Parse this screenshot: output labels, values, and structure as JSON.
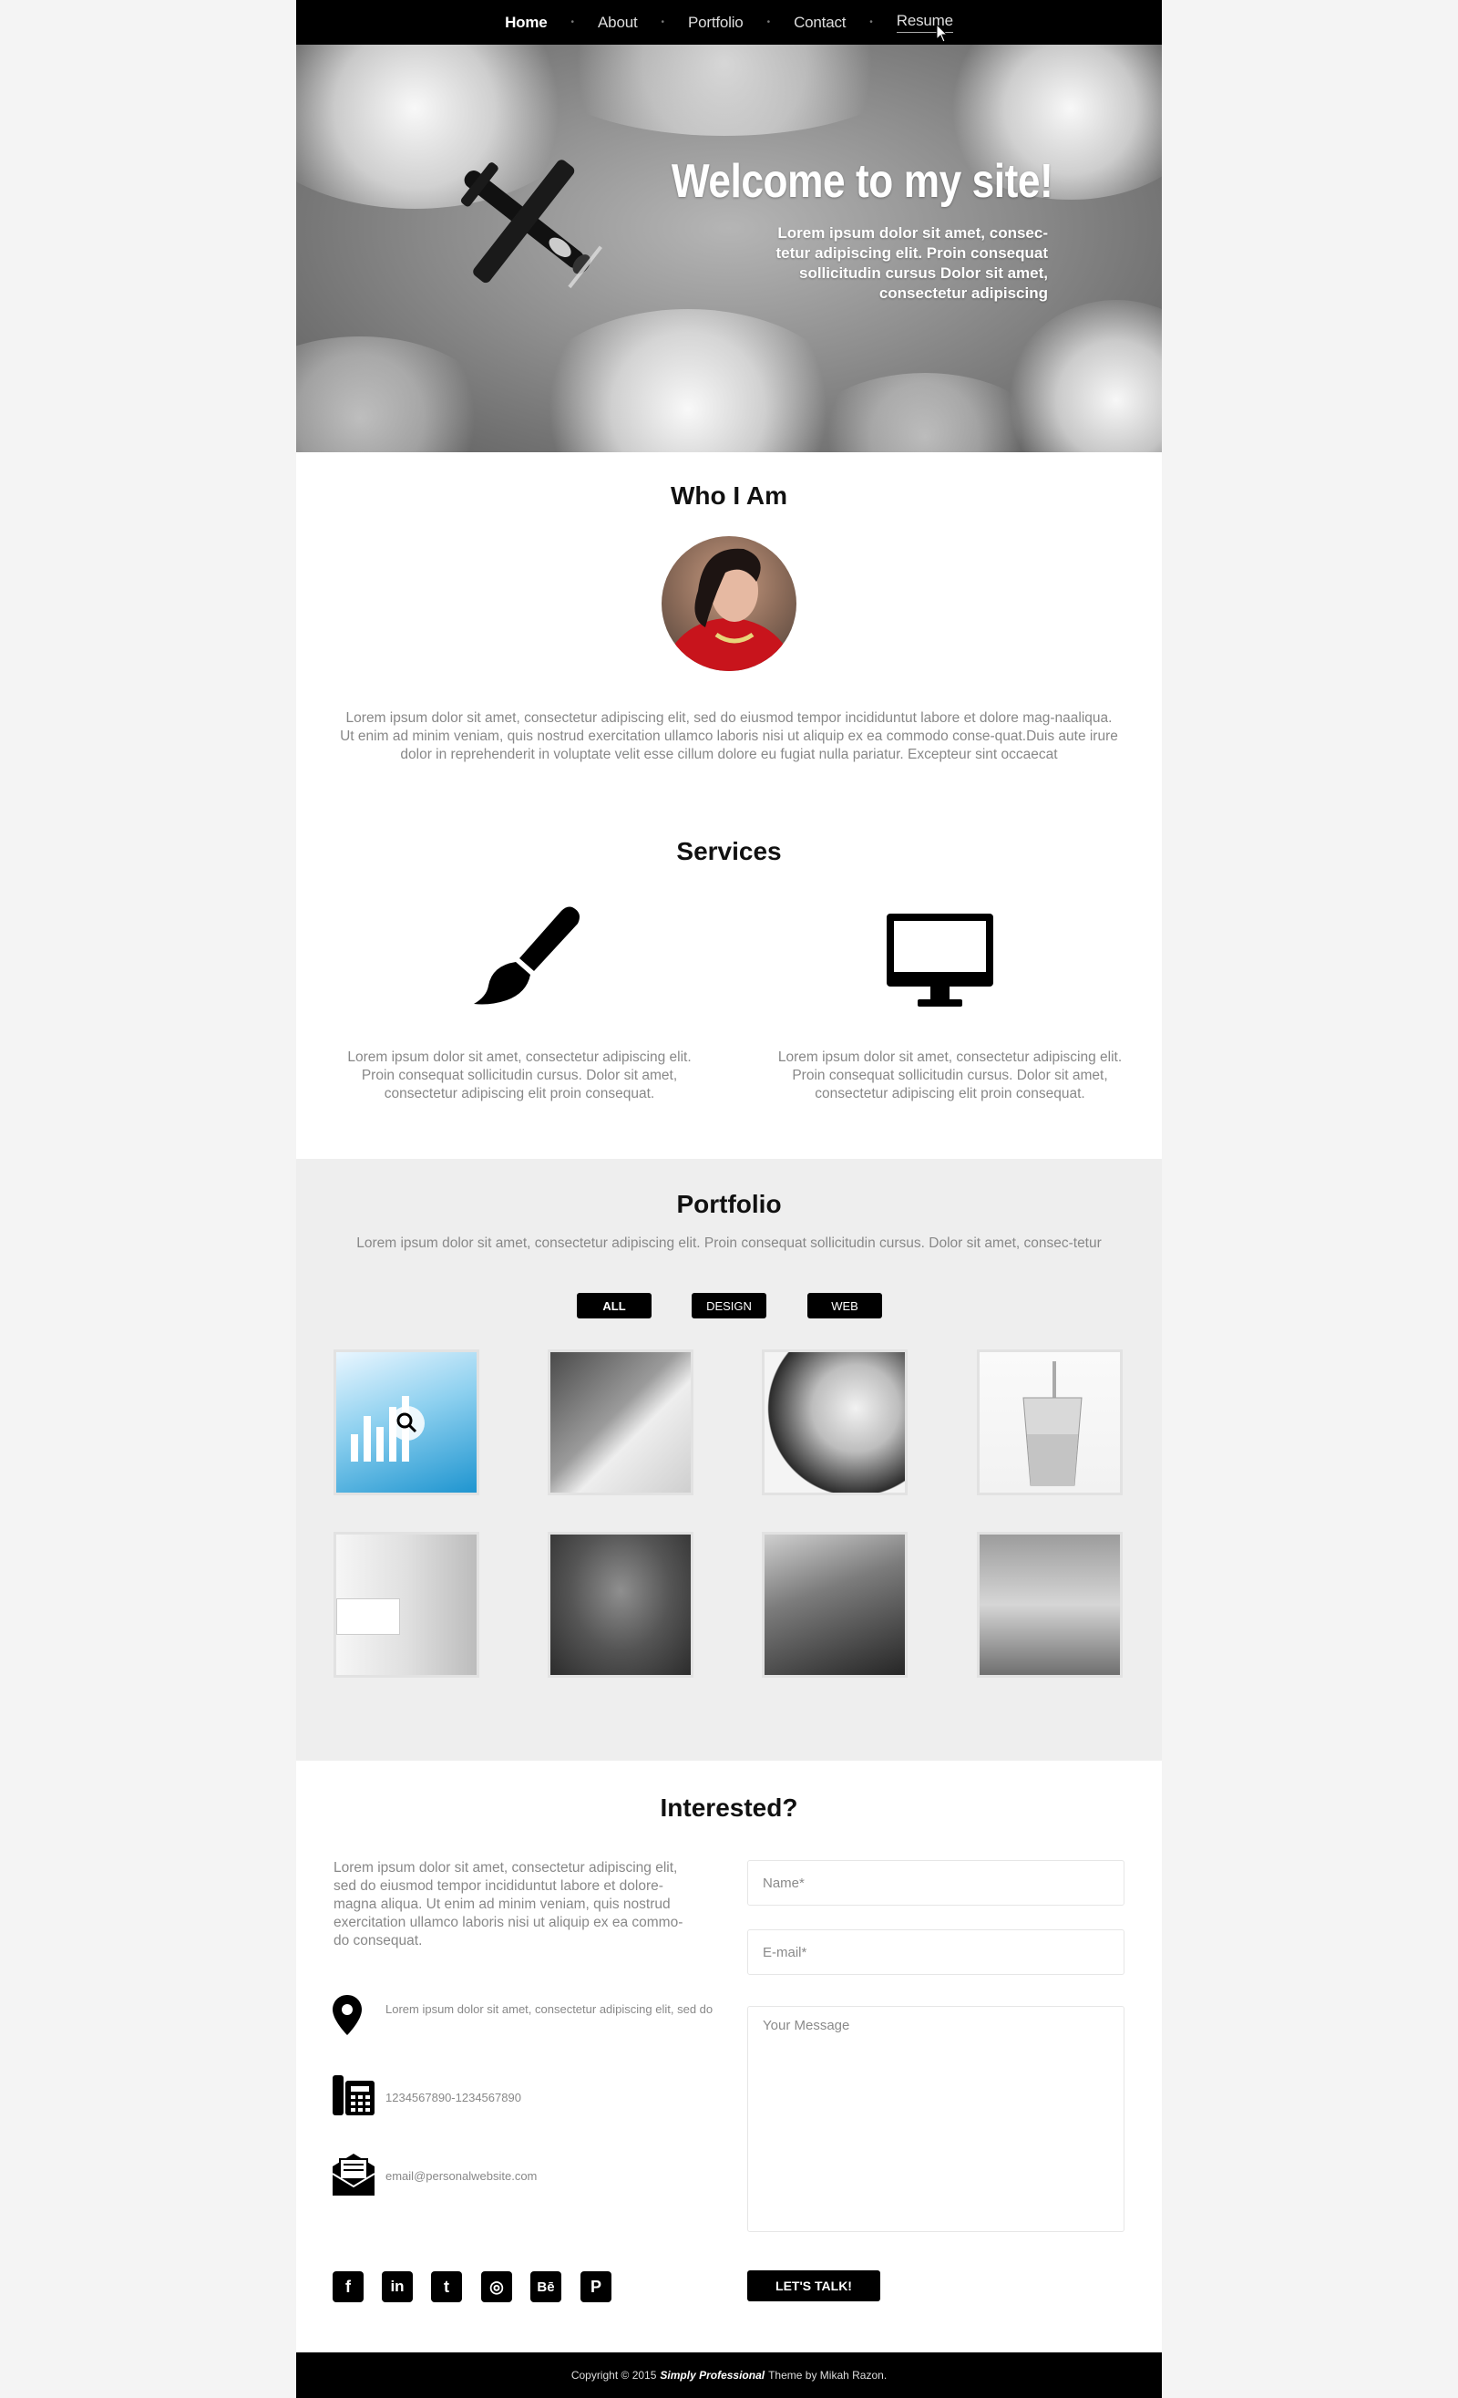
{
  "nav": {
    "items": [
      {
        "label": "Home"
      },
      {
        "label": "About"
      },
      {
        "label": "Portfolio"
      },
      {
        "label": "Contact"
      },
      {
        "label": "Resume"
      }
    ]
  },
  "hero": {
    "title": "Welcome to my site!",
    "text": "Lorem ipsum dolor sit amet, consec-tetur adipiscing elit. Proin consequat sollicitudin cursus Dolor sit amet, consectetur adipiscing"
  },
  "about": {
    "title": "Who I Am",
    "text": "Lorem ipsum dolor sit amet, consectetur adipiscing elit, sed do eiusmod tempor incididuntut labore et dolore mag-naaliqua. Ut enim ad minim veniam, quis  nostrud exercitation ullamco laboris nisi ut aliquip ex ea commodo conse-quat.Duis aute irure dolor in reprehenderit in voluptate velit esse cillum dolore eu fugiat nulla pariatur. Excepteur sint occaecat"
  },
  "services": {
    "title": "Services",
    "items": [
      {
        "icon": "paintbrush-icon",
        "text": "Lorem ipsum dolor sit amet, consectetur adipiscing elit. Proin consequat sollicitudin cursus. Dolor sit amet, consectetur adipiscing elit proin consequat."
      },
      {
        "icon": "monitor-icon",
        "text": "Lorem ipsum dolor sit amet, consectetur adipiscing elit. Proin consequat sollicitudin cursus. Dolor sit amet, consectetur adipiscing elit proin consequat."
      }
    ]
  },
  "portfolio": {
    "title": "Portfolio",
    "text": "Lorem ipsum dolor sit amet, consectetur adipiscing elit. Proin consequat sollicitudin cursus. Dolor sit amet, consec-tetur",
    "filters": [
      {
        "label": "ALL"
      },
      {
        "label": "DESIGN"
      },
      {
        "label": "WEB"
      }
    ]
  },
  "contact": {
    "title": "Interested?",
    "text": "Lorem ipsum dolor sit amet, consectetur adipiscing elit, sed do eiusmod tempor incididuntut labore et dolore-magna aliqua. Ut enim ad minim veniam, quis  nostrud exercitation ullamco laboris nisi ut aliquip ex ea commo-do consequat.",
    "address": "Lorem ipsum dolor sit amet, consectetur adipiscing elit, sed do",
    "phone": "1234567890-1234567890",
    "email": "email@personalwebsite.com",
    "name_placeholder": "Name*",
    "email_placeholder": "E-mail*",
    "message_placeholder": "Your Message",
    "submit_label": "LET'S TALK!",
    "social": [
      {
        "icon": "facebook-icon",
        "glyph": "f"
      },
      {
        "icon": "linkedin-icon",
        "glyph": "in"
      },
      {
        "icon": "twitter-icon",
        "glyph": "t"
      },
      {
        "icon": "dribbble-icon",
        "glyph": "◎"
      },
      {
        "icon": "behance-icon",
        "glyph": "Bē"
      },
      {
        "icon": "pinterest-icon",
        "glyph": "P"
      }
    ]
  },
  "footer": {
    "prefix": "Copyright © 2015",
    "theme": "Simply Professional",
    "suffix": "Theme by Mikah Razon."
  }
}
